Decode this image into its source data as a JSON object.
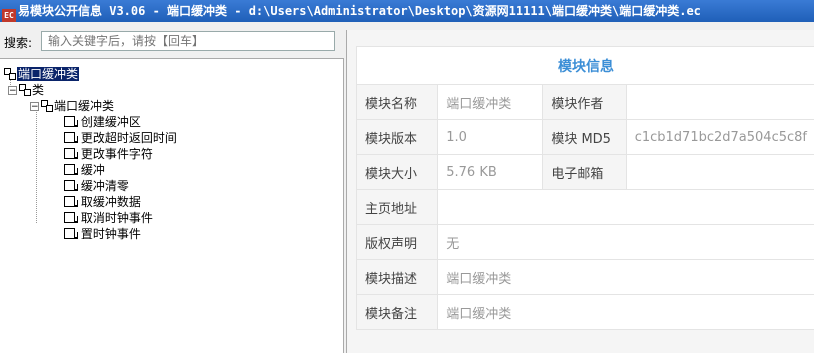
{
  "window": {
    "title": "易模块公开信息 V3.06 - 端口缓冲类 - d:\\Users\\Administrator\\Desktop\\资源网11111\\端口缓冲类\\端口缓冲类.ec",
    "icon_text": "EC"
  },
  "search": {
    "label": "搜索:",
    "placeholder": "输入关键字后，请按【回车】"
  },
  "tree": {
    "root": "端口缓冲类",
    "classes_node": "类",
    "class_name": "端口缓冲类",
    "methods": [
      "创建缓冲区",
      "更改超时返回时间",
      "更改事件字符",
      "缓冲",
      "缓冲清零",
      "取缓冲数据",
      "取消时钟事件",
      "置时钟事件"
    ]
  },
  "info": {
    "header": "模块信息",
    "rows": [
      {
        "label1": "模块名称",
        "value1": "端口缓冲类",
        "label2": "模块作者",
        "value2": ""
      },
      {
        "label1": "模块版本",
        "value1": "1.0",
        "label2": "模块 MD5",
        "value2": "c1cb1d71bc2d7a504c5c8f"
      },
      {
        "label1": "模块大小",
        "value1": "5.76 KB",
        "label2": "电子邮箱",
        "value2": ""
      },
      {
        "label1": "主页地址",
        "value1": ""
      },
      {
        "label1": "版权声明",
        "value1": "无"
      },
      {
        "label1": "模块描述",
        "value1": "端口缓冲类"
      },
      {
        "label1": "模块备注",
        "value1": "端口缓冲类"
      }
    ]
  }
}
